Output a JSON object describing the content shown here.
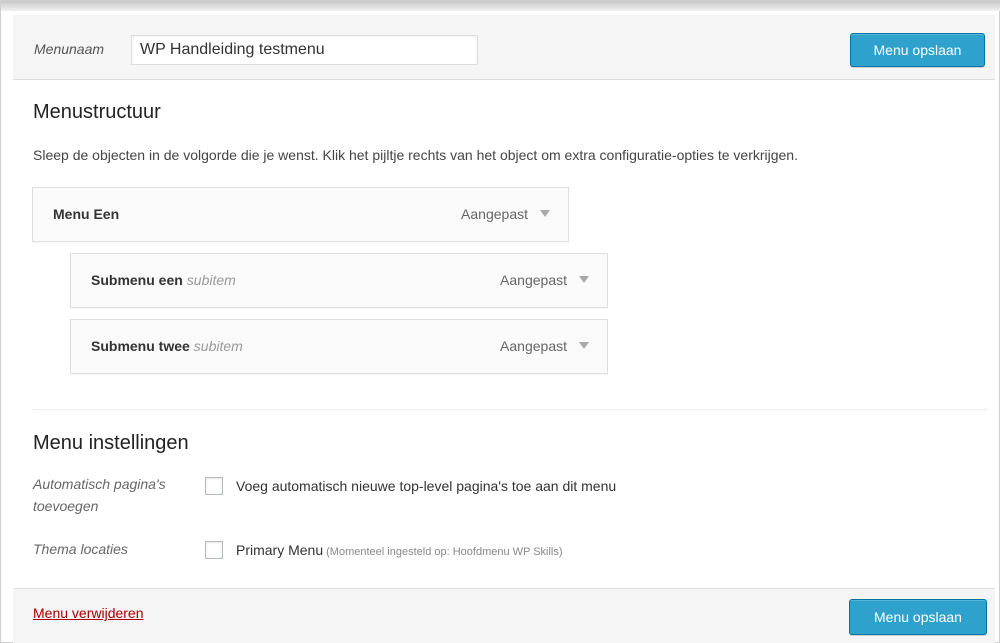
{
  "header": {
    "menu_name_label": "Menunaam",
    "menu_name_value": "WP Handleiding testmenu",
    "save_label": "Menu opslaan"
  },
  "structure": {
    "title": "Menustructuur",
    "help_text": "Sleep de objecten in de volgorde die je wenst. Klik het pijltje rechts van het object om extra configuratie-opties te verkrijgen.",
    "items": [
      {
        "title": "Menu Een",
        "sub_tag": "",
        "type": "Aangepast"
      },
      {
        "title": "Submenu een",
        "sub_tag": "subitem",
        "type": "Aangepast"
      },
      {
        "title": "Submenu twee",
        "sub_tag": "subitem",
        "type": "Aangepast"
      }
    ]
  },
  "settings": {
    "title": "Menu instellingen",
    "auto_add_label": "Automatisch pagina's toevoegen",
    "auto_add_text": "Voeg automatisch nieuwe top-level pagina's toe aan dit menu",
    "auto_add_checked": false,
    "locations_label": "Thema locaties",
    "primary_menu_text": "Primary Menu",
    "primary_menu_note": "(Momenteel ingesteld op: Hoofdmenu WP Skills)",
    "primary_menu_checked": false
  },
  "footer": {
    "delete_label": "Menu verwijderen",
    "save_label": "Menu opslaan"
  },
  "colors": {
    "primary_button": "#2ea2cc",
    "delete_link": "#aa0000"
  }
}
